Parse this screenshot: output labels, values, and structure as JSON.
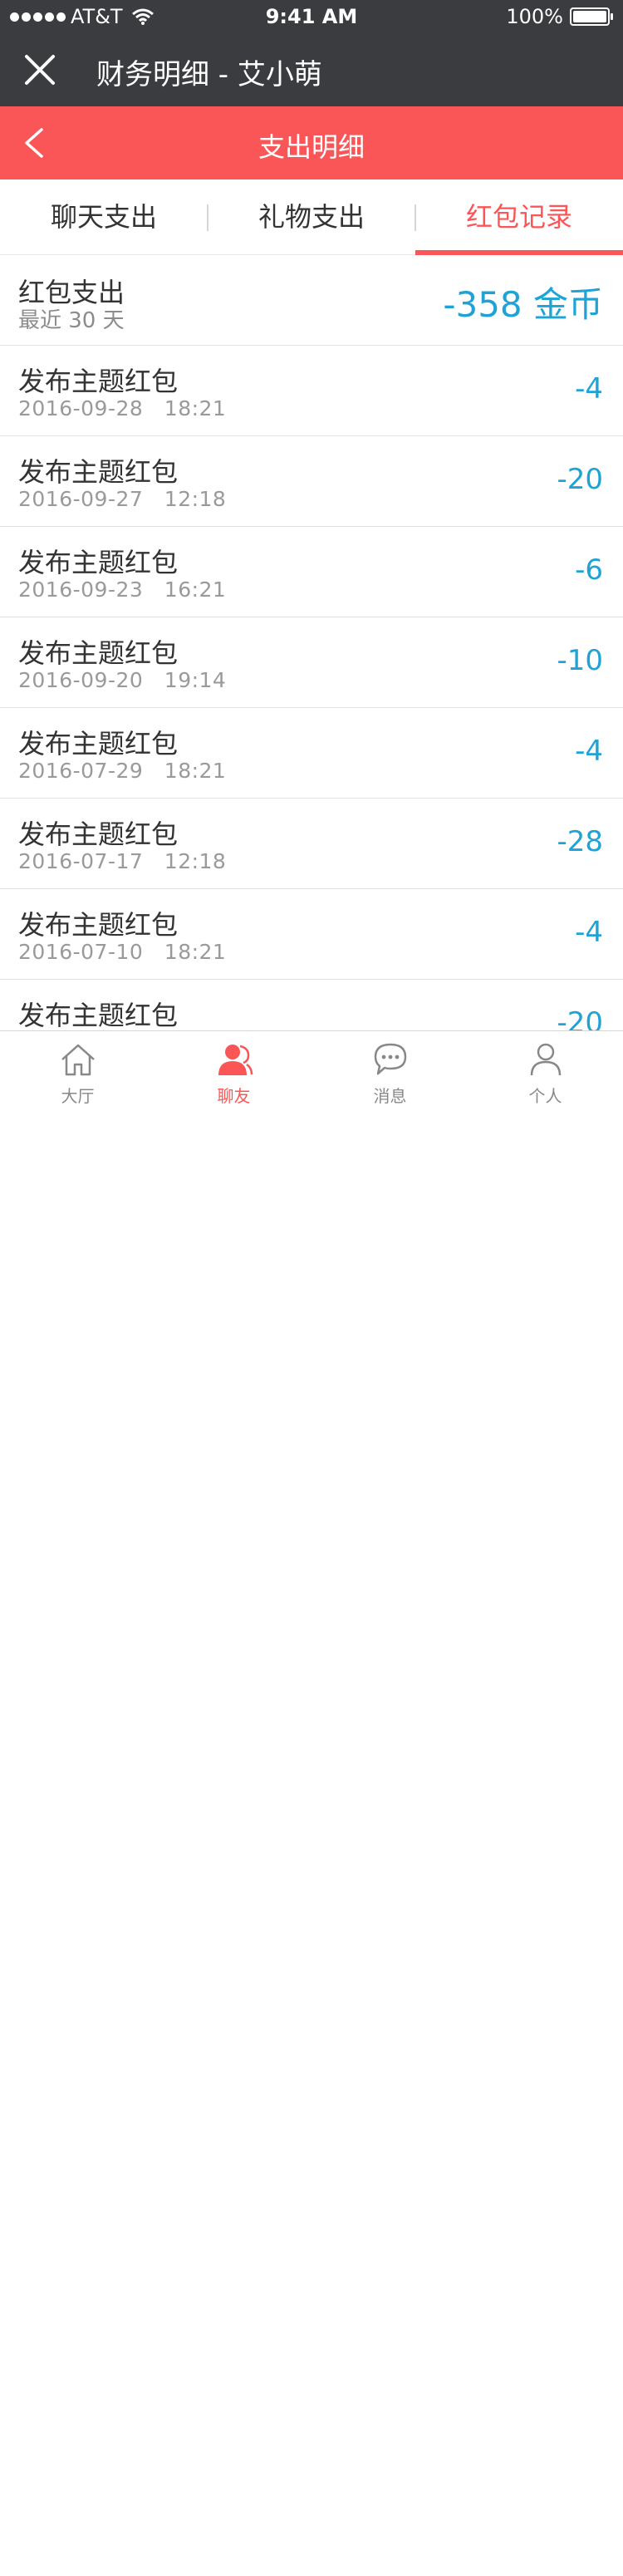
{
  "status_bar": {
    "carrier": "AT&T",
    "time": "9:41 AM",
    "battery": "100%",
    "battery_level": 1.0
  },
  "window": {
    "title": "财务明细 - 艾小萌"
  },
  "subheader": {
    "title": "支出明细"
  },
  "tabs": [
    {
      "label": "聊天支出",
      "active": false
    },
    {
      "label": "礼物支出",
      "active": false
    },
    {
      "label": "红包记录",
      "active": true
    }
  ],
  "summary": {
    "label": "红包支出",
    "sub": "最近 30 天",
    "amount": "-358 金币"
  },
  "records": [
    {
      "name": "发布主题红包",
      "timestamp": "2016-09-28　18:21",
      "value": "-4"
    },
    {
      "name": "发布主题红包",
      "timestamp": "2016-09-27　12:18",
      "value": "-20"
    },
    {
      "name": "发布主题红包",
      "timestamp": "2016-09-23　16:21",
      "value": "-6"
    },
    {
      "name": "发布主题红包",
      "timestamp": "2016-09-20　19:14",
      "value": "-10"
    },
    {
      "name": "发布主题红包",
      "timestamp": "2016-07-29　18:21",
      "value": "-4"
    },
    {
      "name": "发布主题红包",
      "timestamp": "2016-07-17　12:18",
      "value": "-28"
    },
    {
      "name": "发布主题红包",
      "timestamp": "2016-07-10　18:21",
      "value": "-4"
    },
    {
      "name": "发布主题红包",
      "timestamp": "",
      "value": "-20"
    }
  ],
  "tabbar": [
    {
      "label": "大厅",
      "icon": "home-icon",
      "active": false
    },
    {
      "label": "聊友",
      "icon": "friends-icon",
      "active": true
    },
    {
      "label": "消息",
      "icon": "message-icon",
      "active": false
    },
    {
      "label": "个人",
      "icon": "person-icon",
      "active": false
    }
  ],
  "colors": {
    "accent": "#fb5657",
    "value_blue": "#1fa3d6",
    "dark_bar": "#3b3c3f"
  }
}
